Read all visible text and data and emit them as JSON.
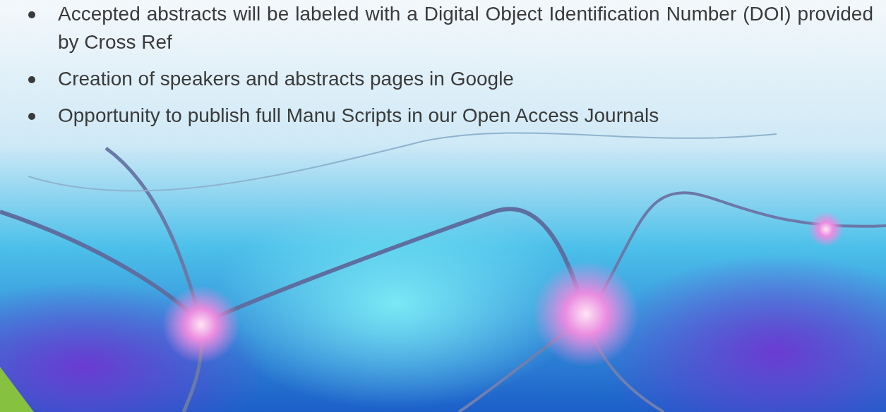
{
  "benefits": [
    {
      "text": "Accepted abstracts will be labeled with a Digital Object Identification Number (DOI) provided by Cross Ref"
    },
    {
      "text": "Creation of speakers and abstracts pages in Google"
    },
    {
      "text": "Opportunity to publish full Manu Scripts in our Open Access Journals"
    }
  ]
}
